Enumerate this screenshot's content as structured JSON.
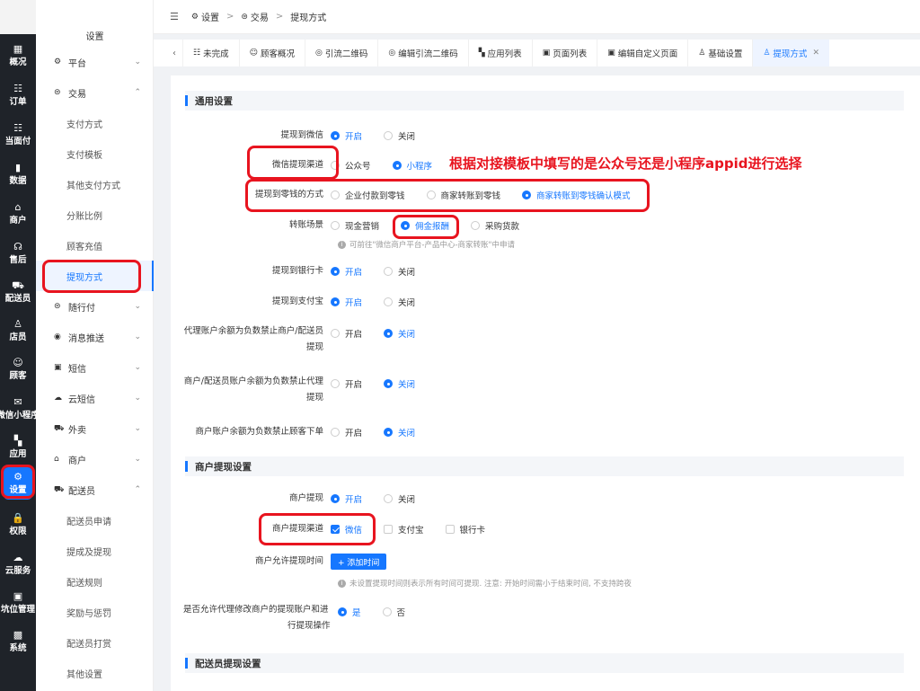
{
  "rail": {
    "items": [
      {
        "icon": "▦",
        "label": "概况"
      },
      {
        "icon": "☷",
        "label": "订单"
      },
      {
        "icon": "☷",
        "label": "当面付"
      },
      {
        "icon": "▮",
        "label": "数据"
      },
      {
        "icon": "⌂",
        "label": "商户"
      },
      {
        "icon": "☊",
        "label": "售后"
      },
      {
        "icon": "⛟",
        "label": "配送员"
      },
      {
        "icon": "♙",
        "label": "店员"
      },
      {
        "icon": "☺",
        "label": "顾客"
      },
      {
        "icon": "✉",
        "label": "微信小程序"
      },
      {
        "icon": "▚",
        "label": "应用"
      },
      {
        "icon": "⚙",
        "label": "设置"
      },
      {
        "icon": "🔒",
        "label": "权限"
      },
      {
        "icon": "☁",
        "label": "云服务"
      },
      {
        "icon": "▣",
        "label": "坑位管理"
      },
      {
        "icon": "▩",
        "label": "系统"
      }
    ]
  },
  "submenu": {
    "title": "设置",
    "platform": "平台",
    "trade": "交易",
    "trade_children": [
      "支付方式",
      "支付模板",
      "其他支付方式",
      "分账比例",
      "顾客充值",
      "提现方式"
    ],
    "pay_along": "随行付",
    "msg_push": "消息推送",
    "sms": "短信",
    "cloud_sms": "云短信",
    "takeout": "外卖",
    "merchant": "商户",
    "rider": "配送员",
    "rider_children": [
      "配送员申请",
      "提成及提现",
      "配送规则",
      "奖励与惩罚",
      "配送员打赏",
      "其他设置"
    ]
  },
  "topbar": {
    "fold_icon": "☰",
    "breadcrumb": [
      "设置",
      "交易",
      "提现方式"
    ]
  },
  "tabs": [
    {
      "icon": "☷",
      "label": "未完成"
    },
    {
      "icon": "☺",
      "label": "顾客概况"
    },
    {
      "icon": "◎",
      "label": "引流二维码"
    },
    {
      "icon": "◎",
      "label": "编辑引流二维码"
    },
    {
      "icon": "▚",
      "label": "应用列表"
    },
    {
      "icon": "▣",
      "label": "页面列表"
    },
    {
      "icon": "▣",
      "label": "编辑自定义页面"
    },
    {
      "icon": "♙",
      "label": "基础设置"
    },
    {
      "icon": "♙",
      "label": "提现方式",
      "active": true
    }
  ],
  "general": {
    "title": "通用设置",
    "withdraw_wechat": {
      "label": "提现到微信",
      "on": "开启",
      "off": "关闭"
    },
    "wechat_channel": {
      "label": "微信提现渠道",
      "opt1": "公众号",
      "opt2": "小程序"
    },
    "change_method": {
      "label": "提现到零钱的方式",
      "opt1": "企业付款到零钱",
      "opt2": "商家转账到零钱",
      "opt3": "商家转账到零钱确认模式"
    },
    "transfer_scene": {
      "label": "转账场景",
      "opt1": "现金营销",
      "opt2": "佣金报酬",
      "opt3": "采购货款"
    },
    "transfer_hint": "可前往\"微信商户平台-产品中心-商家转账\"中申请",
    "withdraw_bank": {
      "label": "提现到银行卡",
      "on": "开启",
      "off": "关闭"
    },
    "withdraw_alipay": {
      "label": "提现到支付宝",
      "on": "开启",
      "off": "关闭"
    },
    "agent_negative": {
      "label1": "代理账户余额为负数禁止商户/配送员",
      "label2": "提现",
      "on": "开启",
      "off": "关闭"
    },
    "merchant_negative": {
      "label1": "商户/配送员账户余额为负数禁止代理",
      "label2": "提现",
      "on": "开启",
      "off": "关闭"
    },
    "merchant_order": {
      "label": "商户账户余额为负数禁止顾客下单",
      "on": "开启",
      "off": "关闭"
    }
  },
  "merchant": {
    "title": "商户提现设置",
    "withdraw": {
      "label": "商户提现",
      "on": "开启",
      "off": "关闭"
    },
    "channel": {
      "label": "商户提现渠道",
      "opt1": "微信",
      "opt2": "支付宝",
      "opt3": "银行卡"
    },
    "time": {
      "label": "商户允许提现时间",
      "button": "+ 添加时间"
    },
    "time_hint": "未设置提现时间则表示所有时间可提现. 注意: 开始时间需小于结束时间, 不支持跨夜",
    "agent_modify": {
      "label1": "是否允许代理修改商户的提现账户和进",
      "label2": "行提现操作",
      "yes": "是",
      "no": "否"
    }
  },
  "rider": {
    "title": "配送员提现设置"
  },
  "annotation": "根据对接模板中填写的是公众号还是小程序appid进行选择",
  "colors": {
    "accent": "#1677ff",
    "annotation": "#e8141f",
    "rail": "#1f2329"
  }
}
